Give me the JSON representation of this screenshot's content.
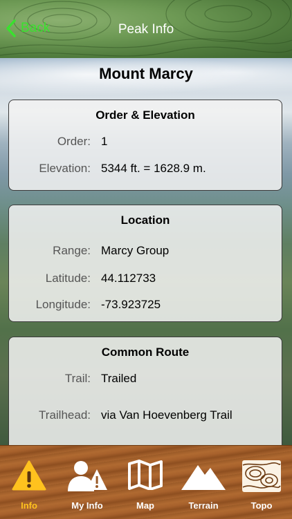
{
  "nav": {
    "back_label": "Back",
    "title": "Peak Info"
  },
  "peak": {
    "name": "Mount Marcy"
  },
  "order_elevation": {
    "title": "Order & Elevation",
    "order_label": "Order:",
    "order_value": "1",
    "elevation_label": "Elevation:",
    "elevation_value": "5344 ft.  =  1628.9 m."
  },
  "location": {
    "title": "Location",
    "range_label": "Range:",
    "range_value": "Marcy Group",
    "latitude_label": "Latitude:",
    "latitude_value": "44.112733",
    "longitude_label": "Longitude:",
    "longitude_value": "-73.923725"
  },
  "route": {
    "title": "Common Route",
    "trail_label": "Trail:",
    "trail_value": "Trailed",
    "trailhead_label": "Trailhead:",
    "trailhead_value": "via Van Hoevenberg Trail"
  },
  "tabs": [
    {
      "label": "Info",
      "icon": "warning-info-icon"
    },
    {
      "label": "My Info",
      "icon": "person-info-icon"
    },
    {
      "label": "Map",
      "icon": "folded-map-icon"
    },
    {
      "label": "Terrain",
      "icon": "mountain-icon"
    },
    {
      "label": "Topo",
      "icon": "topo-contour-icon"
    }
  ],
  "colors": {
    "accent_green": "#39e22e",
    "active_tab": "#ffc21e"
  }
}
